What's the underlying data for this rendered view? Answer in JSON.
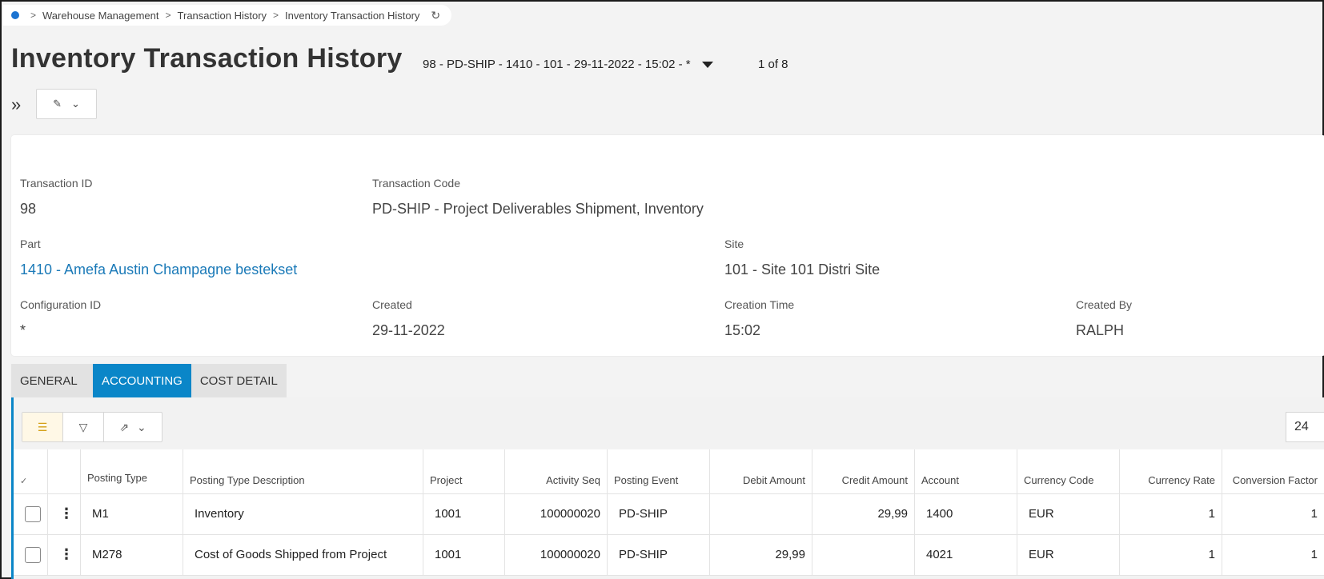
{
  "breadcrumb": {
    "items": [
      "Warehouse Management",
      "Transaction History",
      "Inventory Transaction History"
    ],
    "separator": ">"
  },
  "page": {
    "title": "Inventory Transaction History",
    "record_selector": "98 - PD-SHIP - 1410 - 101 - 29-11-2022 - 15:02 - *",
    "record_count": "1 of 8"
  },
  "header": {
    "transaction_id": {
      "label": "Transaction ID",
      "value": "98"
    },
    "transaction_code": {
      "label": "Transaction Code",
      "value": "PD-SHIP - Project Deliverables Shipment, Inventory"
    },
    "part": {
      "label": "Part",
      "value": "1410 - Amefa Austin Champagne bestekset"
    },
    "site": {
      "label": "Site",
      "value": "101 - Site 101 Distri Site"
    },
    "configuration_id": {
      "label": "Configuration ID",
      "value": "*"
    },
    "created": {
      "label": "Created",
      "value": "29-11-2022"
    },
    "creation_time": {
      "label": "Creation Time",
      "value": "15:02"
    },
    "created_by": {
      "label": "Created By",
      "value": "RALPH"
    }
  },
  "tabs": [
    {
      "label": "General",
      "active": false
    },
    {
      "label": "Accounting",
      "active": true
    },
    {
      "label": "Cost Detail",
      "active": false
    }
  ],
  "grid": {
    "page_size": "24",
    "columns": [
      "Posting Type",
      "Posting Type Description",
      "Project",
      "Activity Seq",
      "Posting Event",
      "Debit Amount",
      "Credit Amount",
      "Account",
      "Currency Code",
      "Currency Rate",
      "Conversion Factor"
    ],
    "rows": [
      [
        "M1",
        "Inventory",
        "1001",
        "100000020",
        "PD-SHIP",
        "",
        "29,99",
        "1400",
        "EUR",
        "1",
        "1"
      ],
      [
        "M278",
        "Cost of Goods Shipped from Project",
        "1001",
        "100000020",
        "PD-SHIP",
        "29,99",
        "",
        "4021",
        "EUR",
        "1",
        "1"
      ]
    ]
  },
  "colors": {
    "accent": "#0a86c8",
    "link": "#1b7ab8",
    "home_dot": "#1b73d1"
  },
  "icons": [
    "home-dot-icon",
    "chevron-right-icon",
    "refresh-icon",
    "caret-down-icon",
    "double-chevron-right-icon",
    "action-menu-icon",
    "list-icon",
    "filter-icon",
    "export-icon",
    "kebab-icon",
    "checkbox-icon"
  ]
}
